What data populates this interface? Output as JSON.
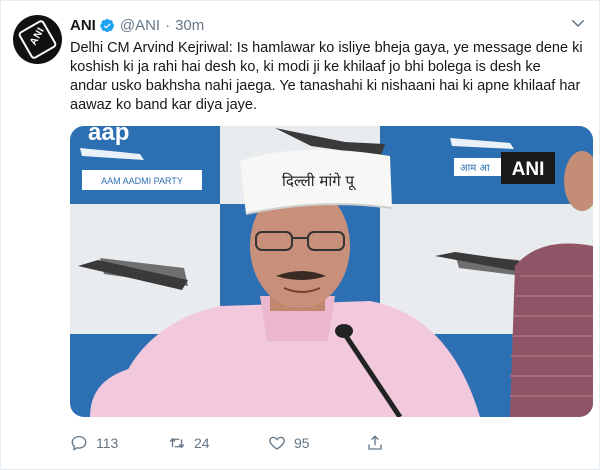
{
  "tweet": {
    "author_name": "ANI",
    "handle": "@ANI",
    "separator": "·",
    "time": "30m",
    "avatar_text": "ANI",
    "text_lines": [
      "Delhi CM Arvind Kejriwal: Is hamlawar ko isliye bheja gaya, ye message dene ki",
      "koshish ki ja rahi hai desh ko, ki modi ji ke khilaaf  jo bhi bolega is desh ke",
      "andar usko bakhsha nahi jaega. Ye tanashahi ki nishaani hai ki apne khilaaf har",
      "aawaz ko band kar diya jaye."
    ]
  },
  "media": {
    "watermark": "ANI",
    "backdrop_party_text": "AAM AADMI PARTY",
    "backdrop_logo_text": "aap",
    "backdrop_hindi_text": "आम आ",
    "cap_text": "दिल्ली मांगे पू"
  },
  "actions": {
    "replies": "113",
    "retweets": "24",
    "likes": "95"
  },
  "colors": {
    "text_primary": "#14171a",
    "text_secondary": "#657786",
    "verified_blue": "#1da1f2",
    "backdrop_blue": "#2d6fb3"
  }
}
